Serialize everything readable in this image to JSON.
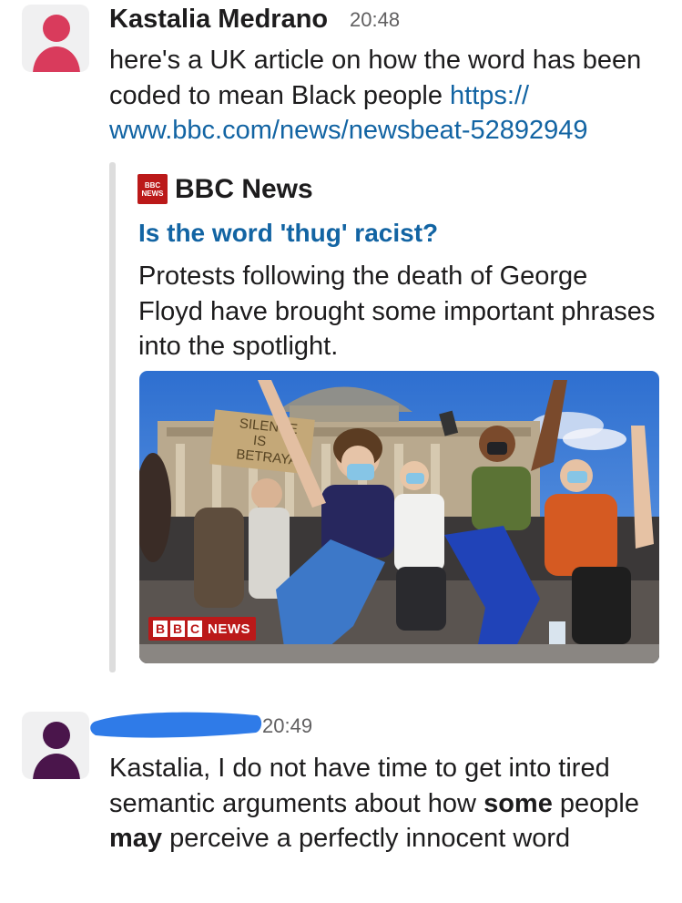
{
  "messages": [
    {
      "author": "Kastalia Medrano",
      "time": "20:48",
      "text_before_link": "here's a UK article on how the word has been coded to mean Black people ",
      "link_text": "https:// www.bbc.com/news/newsbeat-52892949",
      "avatar_color": "#d93b5c"
    },
    {
      "author": "",
      "time": "20:49",
      "text_parts": [
        "Kastalia, I do not have time to get into tired semantic arguments about how ",
        "some",
        " people ",
        "may",
        " perceive a perfectly innocent word"
      ],
      "avatar_color": "#4a154b",
      "redaction_color": "#2f7be8"
    }
  ],
  "unfurl": {
    "source": "BBC News",
    "favicon_text_top": "BBC",
    "favicon_text_bottom": "NEWS",
    "title": "Is the word 'thug' racist?",
    "description": "Protests following the death of George Floyd have brought some important phrases into the spotlight.",
    "image_watermark_letters": [
      "B",
      "B",
      "C"
    ],
    "image_watermark_word": "NEWS",
    "image_sign_text": "SILENCE IS BETRAYAL"
  },
  "colors": {
    "link": "#1264a3",
    "bbc_red": "#bb1919"
  }
}
